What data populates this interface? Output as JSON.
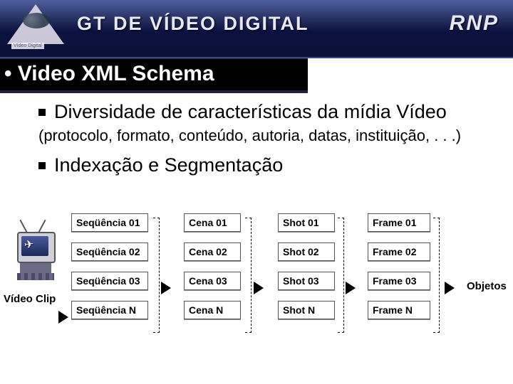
{
  "header": {
    "title_main": "GT DE VÍDEO DIGITAL",
    "title_right": "RNP",
    "logo_label": "Vídeo Digital"
  },
  "slide_title_prefix": "• ",
  "slide_title": "Video XML Schema",
  "bullets": {
    "b1_main": "Diversidade de características da mídia Vídeo",
    "b1_sub": " (protocolo, formato, conteúdo, autoria, datas, instituição, . . .)",
    "b2": "Indexação e Segmentação"
  },
  "diagram": {
    "clip_label": "Vídeo Clip",
    "objects_label": "Objetos",
    "columns": {
      "seq": [
        "Seqüência 01",
        "Seqüência 02",
        "Seqüência 03",
        "Seqüência  N"
      ],
      "cena": [
        "Cena 01",
        "Cena 02",
        "Cena 03",
        "Cena  N"
      ],
      "shot": [
        "Shot 01",
        "Shot 02",
        "Shot 03",
        "Shot  N"
      ],
      "frame": [
        "Frame 01",
        "Frame 02",
        "Frame 03",
        "Frame  N"
      ]
    }
  }
}
